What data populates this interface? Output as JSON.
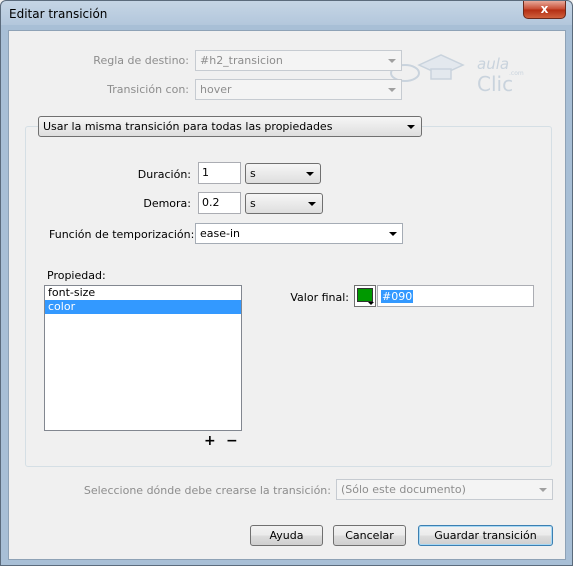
{
  "window": {
    "title": "Editar transición",
    "close_label": "x"
  },
  "logo": {
    "top": "aula",
    "small": ".com",
    "bottom": "Clic"
  },
  "form": {
    "regla_label": "Regla de destino:",
    "regla_value": "#h2_transicion",
    "transicion_label": "Transición con:",
    "transicion_value": "hover",
    "mode_value": "Usar la misma transición para todas las propiedades",
    "duracion_label": "Duración:",
    "duracion_value": "1",
    "duracion_unit": "s",
    "demora_label": "Demora:",
    "demora_value": "0.2",
    "demora_unit": "s",
    "funcion_label": "Función de temporización:",
    "funcion_value": "ease-in",
    "propiedad_label": "Propiedad:",
    "propiedades": [
      {
        "label": "font-size",
        "selected": false
      },
      {
        "label": "color",
        "selected": true
      }
    ],
    "add_label": "+",
    "remove_label": "−",
    "valor_label": "Valor final:",
    "valor_value": "#090",
    "valor_color": "#009900",
    "destino_label": "Seleccione dónde debe crearse la transición:",
    "destino_value": "(Sólo este documento)"
  },
  "buttons": {
    "help": "Ayuda",
    "cancel": "Cancelar",
    "save": "Guardar transición"
  }
}
